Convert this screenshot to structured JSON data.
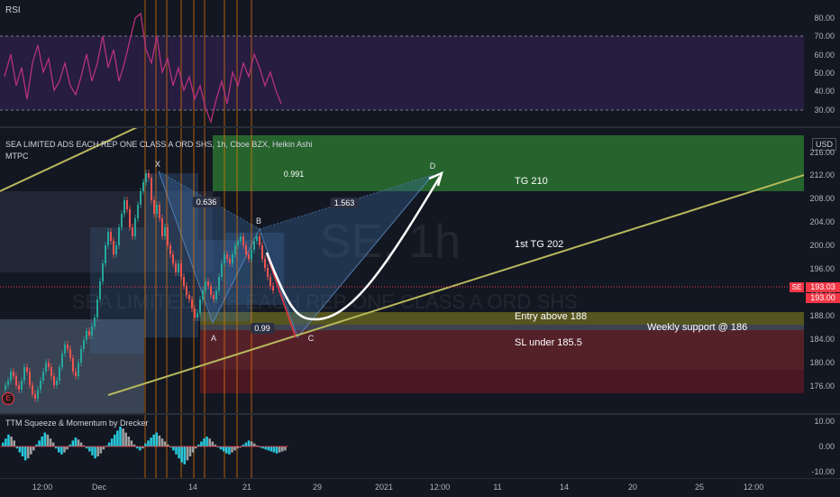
{
  "rsi": {
    "label": "RSI",
    "axis_labels": [
      "80.00",
      "70.00",
      "60.00",
      "50.00",
      "40.00",
      "30.00"
    ]
  },
  "main": {
    "symbol_title": "SEA LIMITED ADS EACH REP ONE CLASS A ORD SHS, 1h, Cboe BZX, Heikin Ashi",
    "indicator": "MTPC",
    "watermark_symbol": "SE, 1h",
    "watermark_name": "SEA LIMITED ADS EACH REP ONE CLASS A ORD SHS",
    "currency": "USD",
    "axis_labels": [
      "216.00",
      "212.00",
      "208.00",
      "204.00",
      "200.00",
      "196.00",
      "192.00",
      "188.00",
      "184.00",
      "180.00",
      "176.00"
    ],
    "price_tags": {
      "symbol": "SE",
      "last": "193.03",
      "line": "193.00"
    },
    "pattern_points": {
      "x": "X",
      "a": "A",
      "b": "B",
      "c": "C",
      "d": "D"
    },
    "ratios": {
      "xab": "0.636",
      "abc": "0.99",
      "bcd": "1.563",
      "xad": "0.991"
    },
    "zones": {
      "tg2": "TG 210",
      "tg1": "1st TG 202",
      "entry": "Entry above 188",
      "support": "Weekly support @ 186",
      "sl": "SL under 185.5"
    },
    "event_marker": "E"
  },
  "ttm": {
    "label": "TTM Squeeze & Momentum by Drecker",
    "axis_labels": [
      "10.00",
      "0.00",
      "-10.00"
    ]
  },
  "time_axis": {
    "labels": [
      "12:00",
      "Dec",
      "14",
      "21",
      "29",
      "2021",
      "12:00",
      "11",
      "14",
      "20",
      "25",
      "12:00"
    ]
  },
  "colors": {
    "up": "#26a69a",
    "down": "#ef5350",
    "rsi_line": "#b7327d",
    "tg_zone": "#2e7d32",
    "sl_zone": "#b71c1c",
    "trendline": "#b8b85c"
  },
  "chart_data": {
    "type": "line",
    "title": "SEA LIMITED ADS EACH REP ONE CLASS A ORD SHS, 1h, Cboe BZX, Heikin Ashi",
    "x": [
      "12:00",
      "Dec",
      "14",
      "21",
      "29",
      "2021"
    ],
    "series": [],
    "ylim": [
      174,
      218
    ]
  }
}
